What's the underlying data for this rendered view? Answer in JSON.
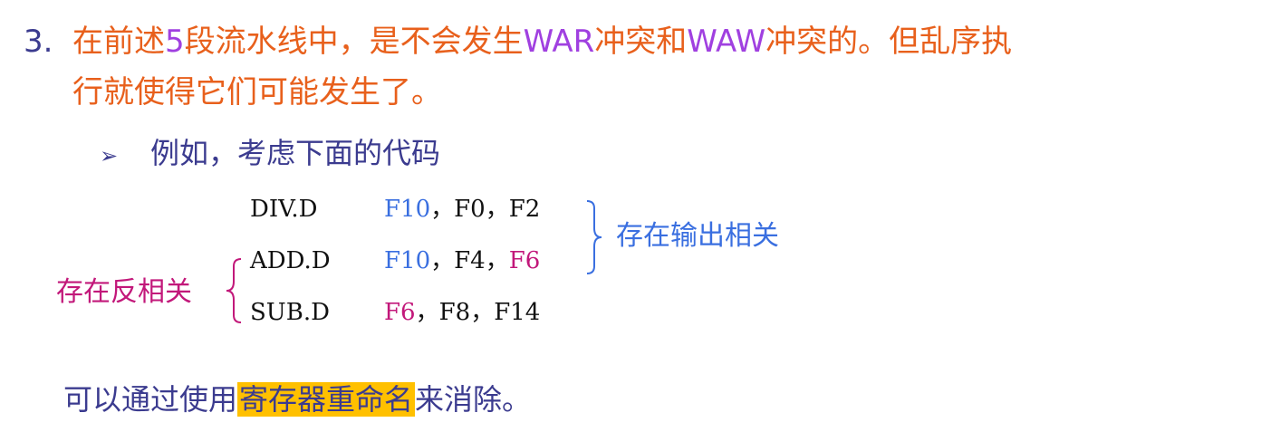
{
  "point": {
    "number": "3.",
    "line1": {
      "t1": "在前述",
      "t2": "5",
      "t3": "段流水线中，是不会发生",
      "t4": "WAR",
      "t5": "冲突和",
      "t6": "WAW",
      "t7": "冲突的。但乱序执"
    },
    "line2": "行就使得它们可能发生了。"
  },
  "sub_bullet": {
    "marker": "➢",
    "text": "例如，考虑下面的代码"
  },
  "code": [
    {
      "op": "DIV.D",
      "r1": "F10",
      "sep1": "，",
      "r2": "F0",
      "sep2": "，",
      "r3": "F2"
    },
    {
      "op": "ADD.D",
      "r1": "F10",
      "sep1": "，",
      "r2": "F4",
      "sep2": "，",
      "r3": "F6"
    },
    {
      "op": "SUB.D",
      "r1": "F6",
      "sep1": "，",
      "r2": "F8",
      "sep2": "，",
      "r3": "F14"
    }
  ],
  "annotations": {
    "output_dependence": "存在输出相关",
    "anti_dependence": "存在反相关"
  },
  "bottom": {
    "prefix": "可以通过使用",
    "highlighted": "寄存器重命名",
    "suffix": "来消除。"
  },
  "colors": {
    "orange": "#e8601c",
    "purple": "#a040e0",
    "navy": "#3b3b8f",
    "blue": "#3a6fe0",
    "magenta": "#c2187a",
    "highlight": "#ffc000"
  }
}
